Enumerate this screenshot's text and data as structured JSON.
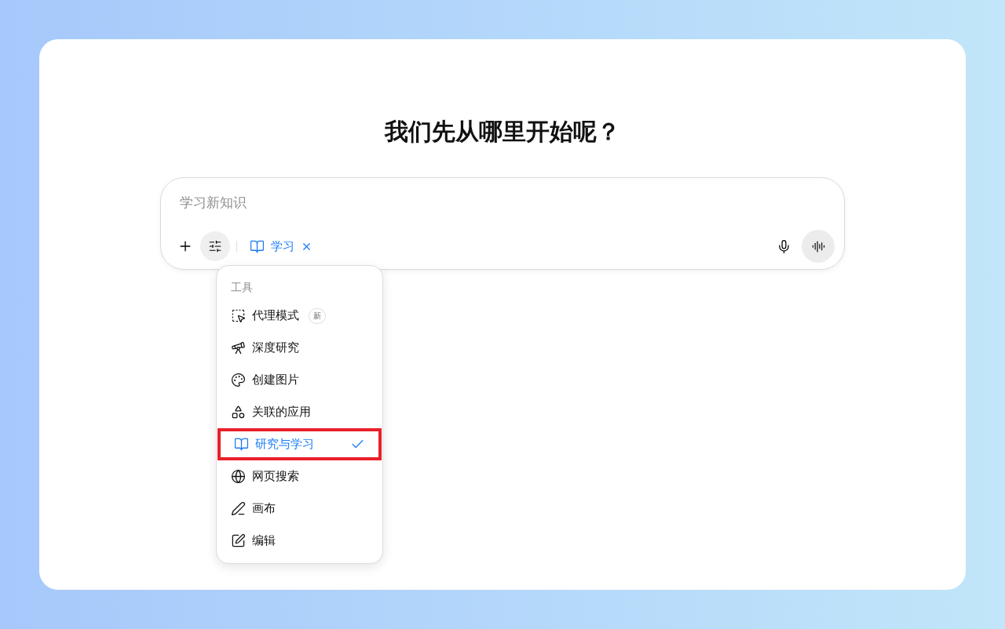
{
  "heading": "我们先从哪里开始呢？",
  "composer": {
    "placeholder": "学习新知识",
    "chip": {
      "label": "学习"
    }
  },
  "menu": {
    "title": "工具",
    "items": [
      {
        "label": "代理模式",
        "badge": "新",
        "selected": false
      },
      {
        "label": "深度研究",
        "selected": false
      },
      {
        "label": "创建图片",
        "selected": false
      },
      {
        "label": "关联的应用",
        "selected": false
      },
      {
        "label": "研究与学习",
        "selected": true
      },
      {
        "label": "网页搜索",
        "selected": false
      },
      {
        "label": "画布",
        "selected": false
      },
      {
        "label": "编辑",
        "selected": false
      }
    ]
  }
}
